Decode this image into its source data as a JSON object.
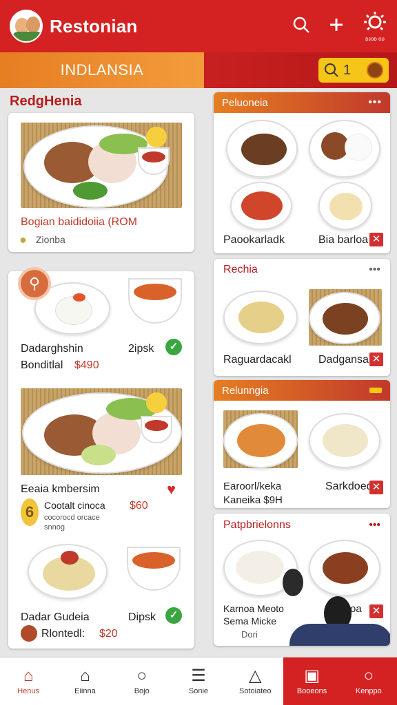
{
  "header": {
    "app_title": "Restonian",
    "icons": [
      "search-icon",
      "plus-icon",
      "sun-settings-icon"
    ],
    "sun_label": "ᴅᴊᴏᴅ ᴏᴜ",
    "accent": "#d42121"
  },
  "banner": {
    "title": "INDLANSIA",
    "search_value": "1"
  },
  "left": {
    "section_title": "RedgHenia",
    "feature": {
      "name": "Bogian baididoiia (ROM",
      "sub": "Zionba"
    },
    "combo": {
      "item1_line1": "Dadarghshin",
      "item1_line2": "Bonditlal",
      "item1_price": "$490",
      "item2": "2ipsk"
    },
    "feature2": {
      "name": "Eeaia kmbersim",
      "sub1": "Cootalt cinoca",
      "price": "$60",
      "sub2": "cocorocd orcace",
      "sub3": "snnog"
    },
    "combo2": {
      "item1": "Dadar Gudeia",
      "item2": "Dipsk",
      "sub": "Rlontedl:",
      "price": "$20"
    }
  },
  "right": {
    "cards": [
      {
        "title": "Peluoneia",
        "left_label": "Paookarladk",
        "right_label": "Bia barloa"
      },
      {
        "title": "Rechia",
        "left_label": "Raguardacakl",
        "right_label": "Dadgansa"
      },
      {
        "title": "Relunngia",
        "left_label": "Earoorl/keka",
        "left_sub": "Kaneika $9H",
        "right_label": "Sarkdoed"
      },
      {
        "title": "Patpbrielonns",
        "left_label": "Karnoa Meoto",
        "left_sub": "Sema Micke",
        "left_sub2": "Dori",
        "right_label": "oa"
      }
    ]
  },
  "bottom_nav": {
    "items": [
      {
        "label": "Henus",
        "icon": "home-icon"
      },
      {
        "label": "Eiinna",
        "icon": "store-icon"
      },
      {
        "label": "Bojo",
        "icon": "apple-icon"
      },
      {
        "label": "Sonie",
        "icon": "list-icon"
      },
      {
        "label": "Sotoiateo",
        "icon": "bell-icon"
      },
      {
        "label": "Booeons",
        "icon": "grid-icon"
      },
      {
        "label": "Kenppo",
        "icon": "circle-icon"
      }
    ]
  }
}
